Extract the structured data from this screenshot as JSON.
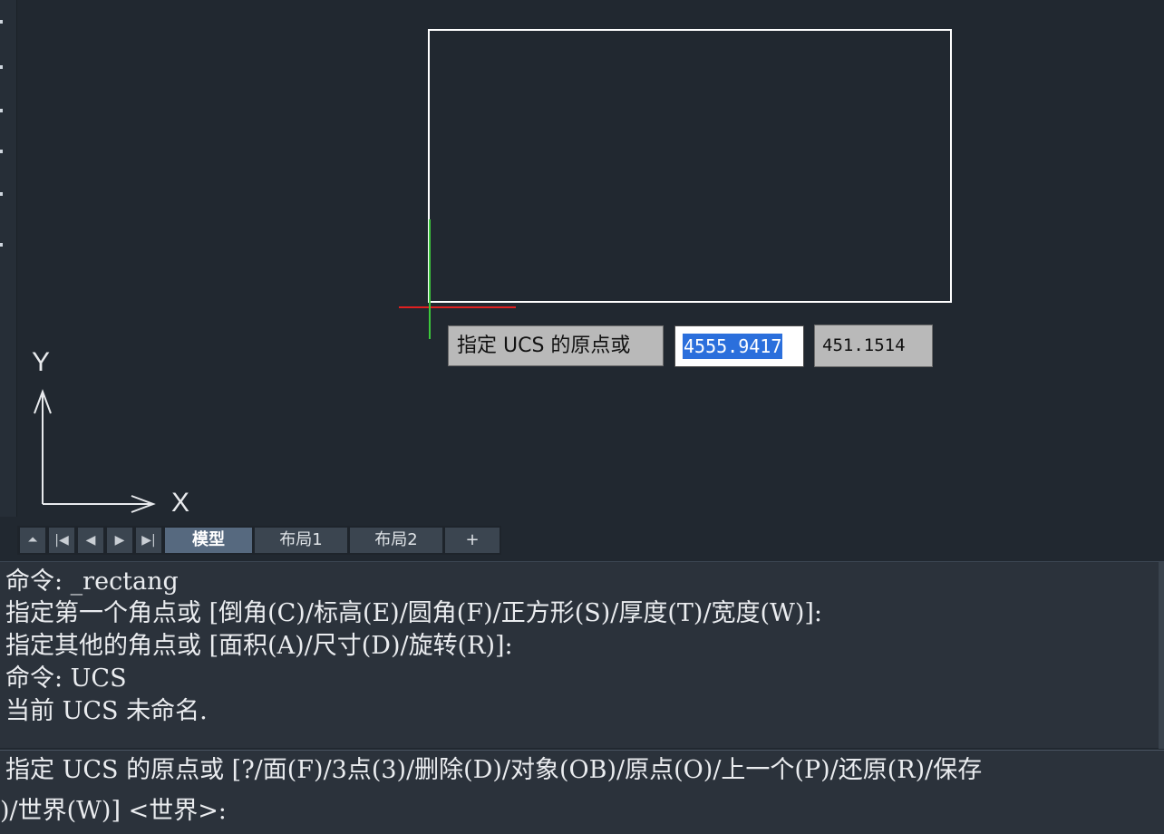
{
  "dynamic_input": {
    "prompt": "指定 UCS 的原点或",
    "x_value": "4555.9417",
    "y_value": "451.1514"
  },
  "ucs_icon": {
    "x_label": "X",
    "y_label": "Y"
  },
  "layout_tabs": {
    "nav": [
      "⏶",
      "|◀",
      "◀",
      "▶",
      "▶|"
    ],
    "tabs": [
      {
        "label": "模型",
        "active": true
      },
      {
        "label": "布局1",
        "active": false
      },
      {
        "label": "布局2",
        "active": false
      }
    ],
    "add_label": "+"
  },
  "command_history": [
    "命令: _rectang",
    "指定第一个角点或 [倒角(C)/标高(E)/圆角(F)/正方形(S)/厚度(T)/宽度(W)]:",
    "指定其他的角点或 [面积(A)/尺寸(D)/旋转(R)]:",
    "命令: UCS",
    "当前 UCS 未命名."
  ],
  "command_current": [
    "指定 UCS 的原点或 [?/面(F)/3点(3)/删除(D)/对象(OB)/原点(O)/上一个(P)/还原(R)/保存",
    ")/世界(W)] <世界>:"
  ],
  "colors": {
    "canvas": "#212830",
    "rectangle": "#ffffff",
    "cursor_x": "#e02020",
    "cursor_y": "#3cc83c",
    "selection": "#2b6fdc"
  }
}
